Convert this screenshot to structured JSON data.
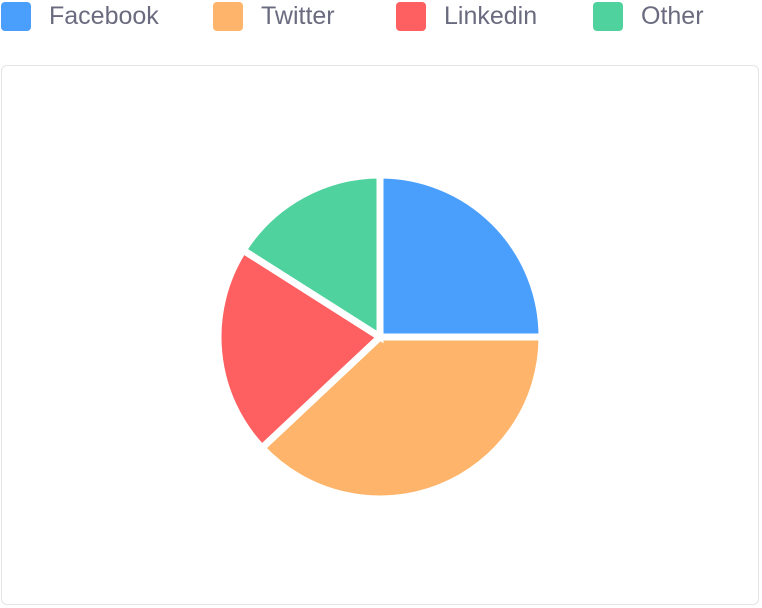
{
  "chart_data": {
    "type": "pie",
    "title": "",
    "legend_position": "top",
    "categories": [
      "Facebook",
      "Twitter",
      "Linkedin",
      "Other"
    ],
    "values": [
      25,
      38,
      21,
      16
    ],
    "colors": [
      "#4a9ffc",
      "#feb56b",
      "#fe6061",
      "#4fd29e"
    ],
    "start_angle_deg": 0,
    "direction": "clockwise"
  }
}
